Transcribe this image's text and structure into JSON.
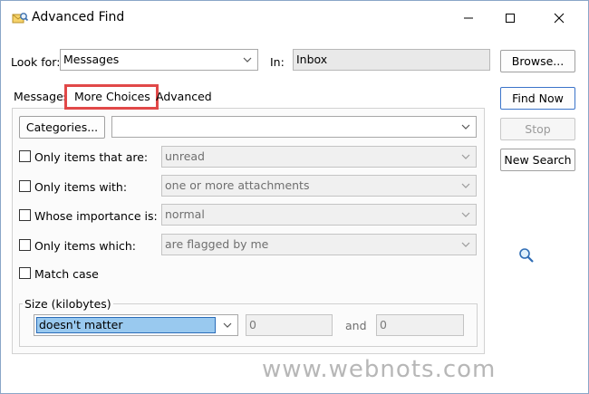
{
  "window": {
    "title": "Advanced Find",
    "icons": {
      "app": "advanced-find-icon",
      "minimize": "minimize-icon",
      "maximize": "maximize-icon",
      "close": "close-icon"
    }
  },
  "look_for": {
    "label": "Look for:",
    "value": "Messages"
  },
  "in": {
    "label": "In:",
    "value": "Inbox"
  },
  "buttons": {
    "browse": "Browse...",
    "find_now": "Find Now",
    "stop": "Stop",
    "new_search": "New Search",
    "categories": "Categories..."
  },
  "tabs": [
    {
      "label": "Messages",
      "selected": false
    },
    {
      "label": "More Choices",
      "selected": true
    },
    {
      "label": "Advanced",
      "selected": false
    }
  ],
  "options": [
    {
      "label": "Only items that are:",
      "checked": false,
      "value": "unread"
    },
    {
      "label": "Only items with:",
      "checked": false,
      "value": "one or more attachments"
    },
    {
      "label": "Whose importance is:",
      "checked": false,
      "value": "normal"
    },
    {
      "label": "Only items which:",
      "checked": false,
      "value": "are flagged by me"
    }
  ],
  "match_case": {
    "label": "Match case",
    "checked": false
  },
  "size": {
    "group_label": "Size (kilobytes)",
    "selected": "doesn't matter",
    "from": "0",
    "and_label": "and",
    "to": "0"
  },
  "highlight_color": "#e14848",
  "watermark": "www.webnots.com"
}
